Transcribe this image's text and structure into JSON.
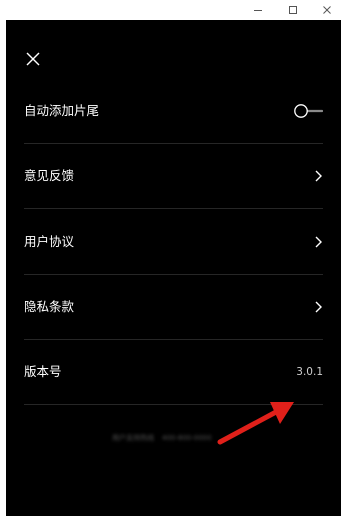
{
  "window_controls": {
    "minimize_icon": "minimize-icon",
    "maximize_icon": "maximize-icon",
    "close_icon": "close-icon"
  },
  "settings": {
    "close_icon": "close-icon",
    "items": [
      {
        "label": "自动添加片尾",
        "control": "toggle",
        "toggle_on": false
      },
      {
        "label": "意见反馈",
        "control": "chevron"
      },
      {
        "label": "用户协议",
        "control": "chevron"
      },
      {
        "label": "隐私条款",
        "control": "chevron"
      },
      {
        "label": "版本号",
        "control": "value",
        "value": "3.0.1"
      }
    ]
  },
  "footer": {
    "left_text": "用户支持热线",
    "right_text": "400-800-0000"
  },
  "annotation": {
    "arrow_color": "#e0201a"
  },
  "colors": {
    "panel_bg": "#000000",
    "text": "#ffffff",
    "divider": "#262626"
  }
}
